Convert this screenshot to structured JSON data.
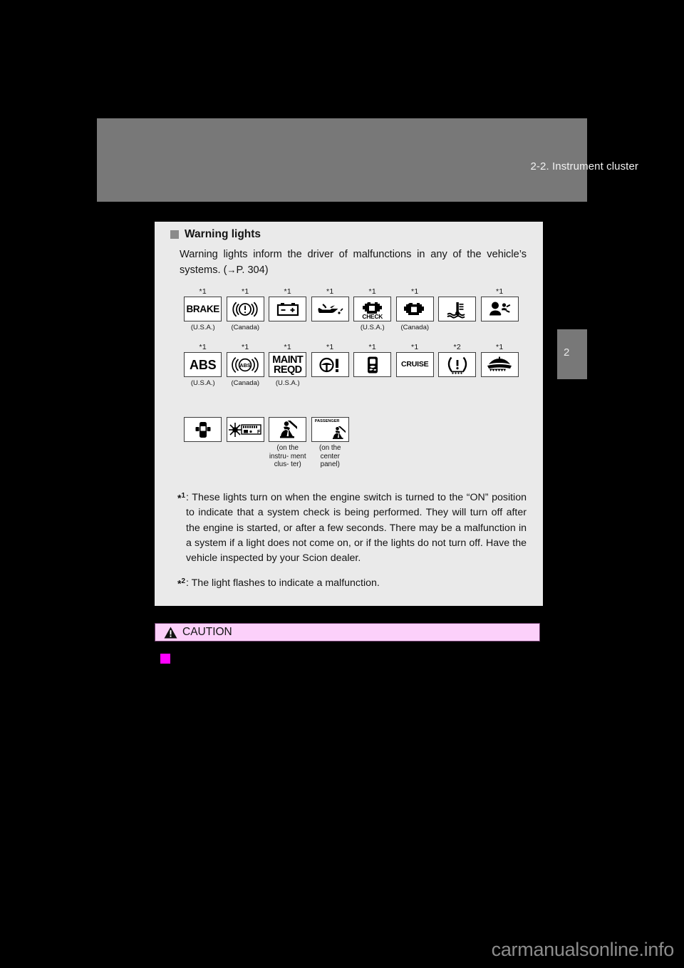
{
  "page": {
    "header_title": "2-2. Instrument cluster",
    "chapter_tab_number": "2",
    "watermark": "carmanualsonline.info",
    "colors": {
      "page_background": "#000000",
      "header_band": "#787878",
      "panel_background": "#eaeaea",
      "caution_background": "#fcd0fa",
      "caution_border": "#6a3b68",
      "magenta_marker": "#ff00ff"
    }
  },
  "section": {
    "heading": "Warning lights",
    "intro": "Warning lights inform the driver of malfunctions in any of the vehicle’s systems. (",
    "intro_ref_arrow": "→",
    "intro_ref_page": "P. 304",
    "intro_ref_close": ")"
  },
  "icon_rows": [
    {
      "row_name": "warning-lights-row-1",
      "cells": [
        {
          "icon": "brake-warning-icon",
          "label": "BRAKE",
          "footnote": "*1",
          "caption": "(U.S.A.)"
        },
        {
          "icon": "brake-system-canada-icon",
          "label": "",
          "footnote": "*1",
          "caption": "(Canada)"
        },
        {
          "icon": "charging-system-battery-icon",
          "label": "",
          "footnote": "*1",
          "caption": ""
        },
        {
          "icon": "low-engine-oil-pressure-icon",
          "label": "",
          "footnote": "*1",
          "caption": ""
        },
        {
          "icon": "check-engine-usa-icon",
          "label": "CHECK",
          "footnote": "*1",
          "caption": "(U.S.A.)"
        },
        {
          "icon": "check-engine-canada-icon",
          "label": "",
          "footnote": "*1",
          "caption": "(Canada)"
        },
        {
          "icon": "high-engine-coolant-temperature-icon",
          "label": "",
          "footnote": "",
          "caption": ""
        },
        {
          "icon": "srs-airbag-warning-icon",
          "label": "",
          "footnote": "*1",
          "caption": ""
        }
      ]
    },
    {
      "row_name": "warning-lights-row-2",
      "cells": [
        {
          "icon": "abs-warning-usa-icon",
          "label": "ABS",
          "footnote": "*1",
          "caption": "(U.S.A.)"
        },
        {
          "icon": "abs-warning-canada-icon",
          "label": "ABS",
          "footnote": "*1",
          "caption": "(Canada)"
        },
        {
          "icon": "maintenance-required-icon",
          "label": "MAINT REQD",
          "footnote": "*1",
          "caption": "(U.S.A.)"
        },
        {
          "icon": "electric-power-steering-icon",
          "label": "",
          "footnote": "*1",
          "caption": ""
        },
        {
          "icon": "slip-indicator-icon",
          "label": "",
          "footnote": "*1",
          "caption": ""
        },
        {
          "icon": "cruise-control-icon",
          "label": "CRUISE",
          "footnote": "*1",
          "caption": ""
        },
        {
          "icon": "low-tire-pressure-icon",
          "label": "",
          "footnote": "*2",
          "caption": ""
        },
        {
          "icon": "open-door-hatch-icon",
          "label": "",
          "footnote": "*1",
          "caption": ""
        }
      ]
    },
    {
      "row_name": "warning-lights-row-3",
      "cells": [
        {
          "icon": "open-door-vehicle-icon",
          "label": "",
          "footnote": "",
          "caption": ""
        },
        {
          "icon": "low-fuel-level-icon",
          "label": "F",
          "footnote": "",
          "caption": ""
        },
        {
          "icon": "driver-seat-belt-reminder-icon",
          "label": "",
          "footnote": "",
          "caption": "(on the instru- ment clus- ter)"
        },
        {
          "icon": "passenger-seat-belt-reminder-icon",
          "label": "PASSENGER",
          "footnote": "",
          "caption": "(on the center panel)"
        }
      ]
    }
  ],
  "footnotes": [
    {
      "mark": "*1",
      "mark_digit": "1",
      "text": ": These lights turn on when the engine switch is turned to the “ON” position to indicate that a system check is being performed. They will turn off after the engine is started, or after a few seconds. There may be a malfunction in a system if a light does not come on, or if the lights do not turn off. Have the vehicle inspected by your Scion dealer."
    },
    {
      "mark": "*2",
      "mark_digit": "2",
      "text": ": The light flashes to indicate a malfunction."
    }
  ],
  "caution": {
    "label": "CAUTION",
    "icon": "warning-triangle-icon"
  }
}
